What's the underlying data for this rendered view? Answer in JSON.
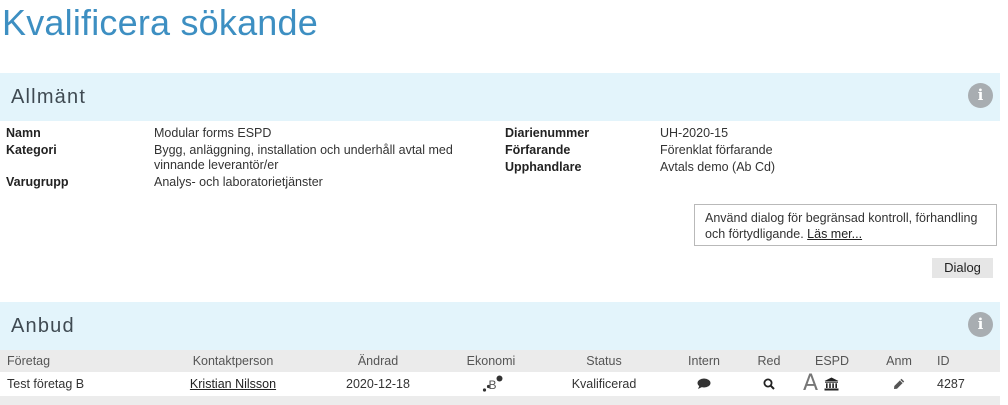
{
  "page": {
    "title": "Kvalificera sökande"
  },
  "allmant": {
    "title": "Allmänt",
    "info_icon": "info-icon",
    "fields_left": [
      {
        "label": "Namn",
        "value": "Modular forms ESPD"
      },
      {
        "label": "Kategori",
        "value": "Bygg, anläggning, installation och underhåll avtal med vinnande leverantör/er"
      },
      {
        "label": "Varugrupp",
        "value": "Analys- och laboratorietjänster"
      }
    ],
    "fields_right": [
      {
        "label": "Diarienummer",
        "value": "UH-2020-15"
      },
      {
        "label": "Förfarande",
        "value": "Förenklat förfarande"
      },
      {
        "label": "Upphandlare",
        "value": "Avtals demo (Ab Cd)"
      }
    ],
    "dialog_info": {
      "text": "Använd dialog för begränsad kontroll, förhandling och förtydligande.",
      "link": "Läs mer..."
    },
    "dialog_button": "Dialog"
  },
  "anbud": {
    "title": "Anbud",
    "info_icon": "info-icon",
    "columns": [
      "Företag",
      "Kontaktperson",
      "Ändrad",
      "Ekonomi",
      "Status",
      "Intern",
      "Red",
      "ESPD",
      "Anm",
      "ID"
    ],
    "rows": [
      {
        "company": "Test företag B",
        "contact": "Kristian Nilsson",
        "changed": "2020-12-18",
        "economy_icon": "credit-rating-b-icon",
        "economy_letter": "B",
        "status": "Kvalificerad",
        "intern_icon": "comment-icon",
        "red_icon": "search-icon",
        "espd_letter": "A",
        "espd_icon": "bank-icon",
        "anm_icon": "pencil-icon",
        "id": "4287"
      }
    ]
  },
  "colors": {
    "accent": "#3d8fc2",
    "panel_header_bg": "#e3f4fb",
    "table_header_bg": "#ebebeb"
  }
}
